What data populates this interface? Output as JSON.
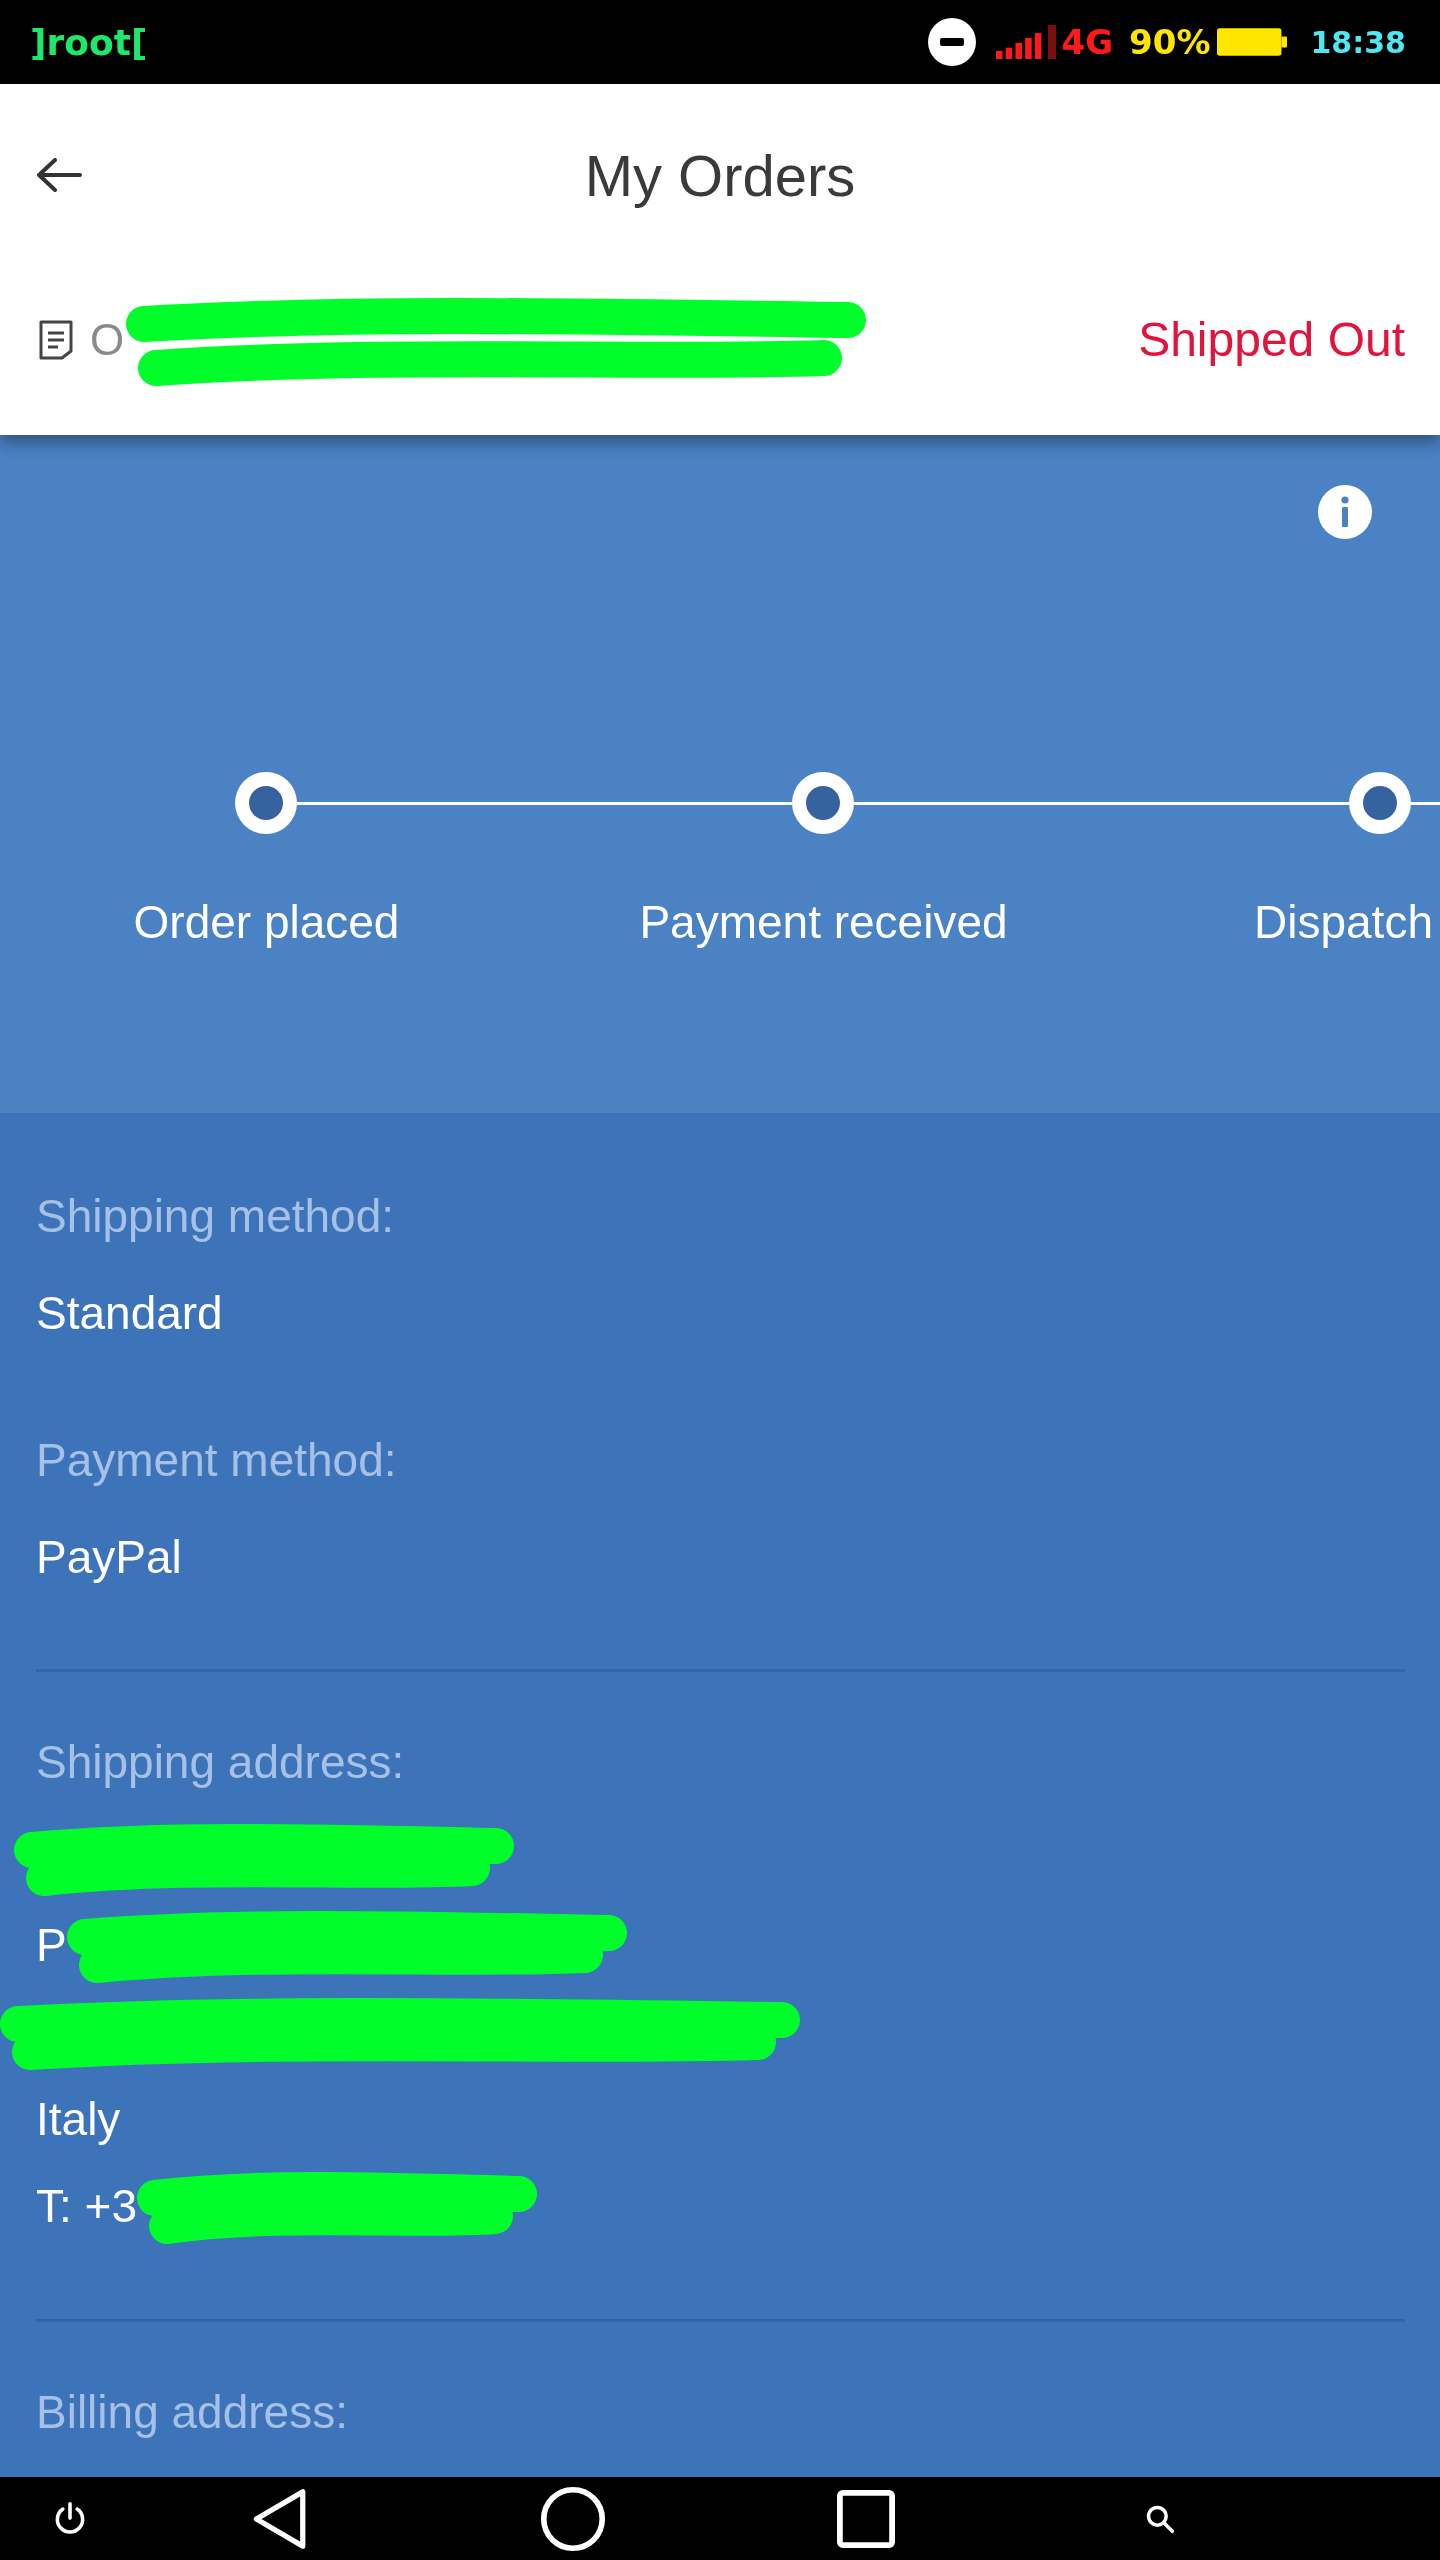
{
  "status_bar": {
    "label": "]root[",
    "network": "4G",
    "battery": "90%",
    "time": "18:38"
  },
  "app_bar": {
    "title": "My Orders"
  },
  "order": {
    "number": {
      "kind": "partly_redacted",
      "text": "O"
    },
    "status": "Shipped Out"
  },
  "timeline": {
    "steps": [
      {
        "label": "Order placed"
      },
      {
        "label": "Payment received"
      },
      {
        "label": "Dispatch"
      }
    ]
  },
  "details": [
    {
      "kind": "field",
      "label": "Shipping method:",
      "value": "Standard"
    },
    {
      "kind": "field",
      "label": "Payment method:",
      "value": "PayPal"
    },
    {
      "kind": "divider"
    },
    {
      "kind": "address",
      "label": "Shipping address:",
      "lines": [
        {
          "kind": "redacted"
        },
        {
          "kind": "partly_redacted",
          "text": "P"
        },
        {
          "kind": "redacted"
        },
        {
          "kind": "text",
          "text": "Italy"
        },
        {
          "kind": "partly_redacted",
          "text": "T: +3"
        }
      ]
    },
    {
      "kind": "divider"
    },
    {
      "kind": "heading",
      "label": "Billing address:"
    }
  ]
}
